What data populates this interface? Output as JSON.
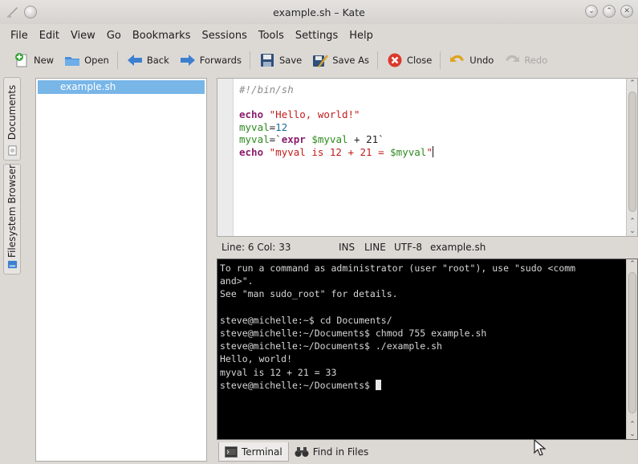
{
  "window": {
    "title": "example.sh – Kate"
  },
  "menubar": [
    "File",
    "Edit",
    "View",
    "Go",
    "Bookmarks",
    "Sessions",
    "Tools",
    "Settings",
    "Help"
  ],
  "toolbar": [
    {
      "label": "New",
      "icon": "document-new-icon",
      "enabled": true
    },
    {
      "label": "Open",
      "icon": "folder-open-icon",
      "enabled": true
    },
    {
      "label": "Back",
      "icon": "arrow-left-icon",
      "enabled": true
    },
    {
      "label": "Forwards",
      "icon": "arrow-right-icon",
      "enabled": true
    },
    {
      "label": "Save",
      "icon": "floppy-disk-icon",
      "enabled": true
    },
    {
      "label": "Save As",
      "icon": "save-as-icon",
      "enabled": true
    },
    {
      "label": "Close",
      "icon": "close-circle-icon",
      "enabled": true
    },
    {
      "label": "Undo",
      "icon": "undo-icon",
      "enabled": true
    },
    {
      "label": "Redo",
      "icon": "redo-icon",
      "enabled": false
    }
  ],
  "sidetabs": {
    "documents": "Documents",
    "filesystem": "Filesystem Browser"
  },
  "filelist": {
    "items": [
      "example.sh"
    ]
  },
  "editor": {
    "line1": "#!/bin/sh",
    "line3_kw": "echo",
    "line3_str": "\"Hello, world!\"",
    "line4_var": "myval",
    "line4_eq": "=",
    "line4_num": "12",
    "line5_var": "myval",
    "line5_eq": "=`",
    "line5_kw": "expr",
    "line5_ref": "$myval",
    "line5_rest": " + 21`",
    "line6_kw": "echo",
    "line6_str": "\"myval is 12 + 21 = ",
    "line6_ref": "$myval",
    "line6_end": "\""
  },
  "statusbar": {
    "position": "Line: 6 Col: 33",
    "mode": "INS",
    "select_mode": "LINE",
    "encoding": "UTF-8",
    "filename": "example.sh"
  },
  "terminal": {
    "lines": [
      "To run a command as administrator (user \"root\"), use \"sudo <comm",
      "and>\".",
      "See \"man sudo_root\" for details.",
      "",
      "steve@michelle:~$ cd Documents/",
      "steve@michelle:~/Documents$ chmod 755 example.sh",
      "steve@michelle:~/Documents$ ./example.sh",
      "Hello, world!",
      "myval is 12 + 21 = 33",
      "steve@michelle:~/Documents$ "
    ]
  },
  "bottomtabs": [
    {
      "label": "Terminal",
      "icon": "terminal-icon",
      "active": true
    },
    {
      "label": "Find in Files",
      "icon": "binoculars-icon",
      "active": false
    }
  ]
}
